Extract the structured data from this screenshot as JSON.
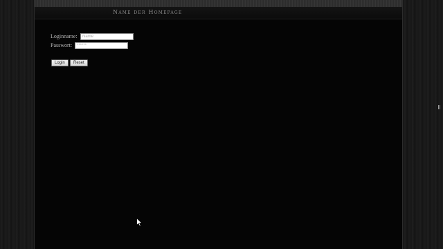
{
  "header": {
    "site_title": "Name der Homepage"
  },
  "login_form": {
    "username_label": "Loginname:",
    "username_placeholder": "Name",
    "password_label": "Passwort:",
    "password_value": "******",
    "login_button": "Login",
    "reset_button": "Reset"
  },
  "icons": {
    "cursor": "mouse-pointer-icon",
    "side_handle": "resize-grip-icon"
  }
}
